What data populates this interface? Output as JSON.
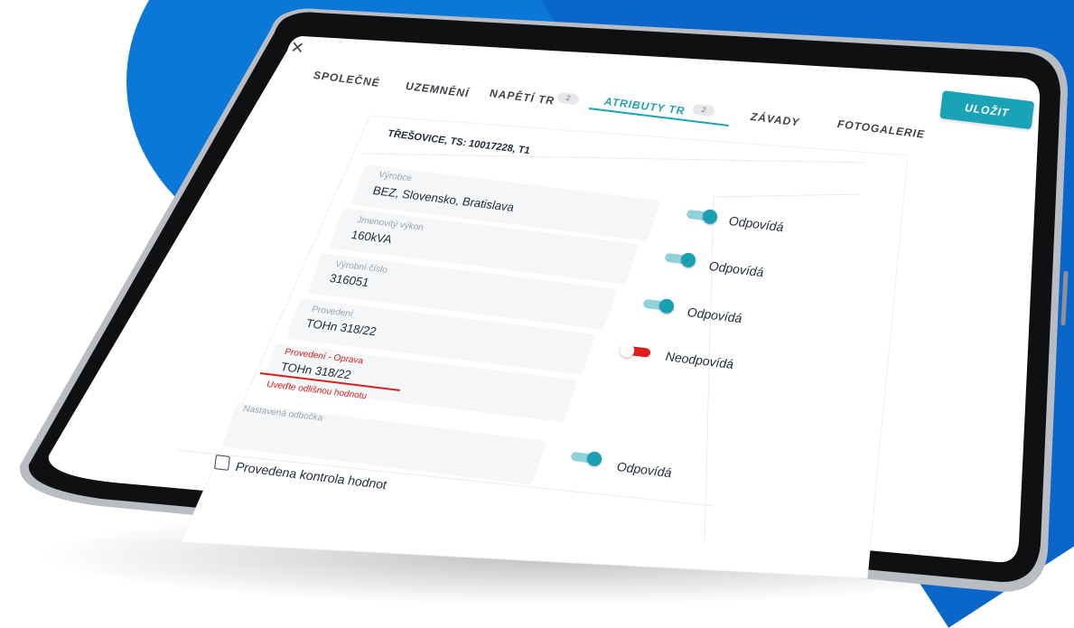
{
  "tabs": [
    {
      "label": "SPOLEČNÉ"
    },
    {
      "label": "UZEMNĚNÍ"
    },
    {
      "label": "NAPĚTÍ TR",
      "badge": "2"
    },
    {
      "label": "ATRIBUTY TR",
      "badge": "2",
      "active": true
    },
    {
      "label": "ZÁVADY"
    },
    {
      "label": "FOTOGALERIE"
    }
  ],
  "save_label": "ULOŽIT",
  "close_icon": "close-icon",
  "panel_title": "TŘEŠOVICE, TS: 10017228, T1",
  "fields": [
    {
      "label": "Výrobce",
      "value": "BEZ, Slovensko, Bratislava",
      "status": "Odpovídá",
      "toggle": "on"
    },
    {
      "label": "Jmenovitý výkon",
      "value": "160kVA",
      "status": "Odpovídá",
      "toggle": "on"
    },
    {
      "label": "Výrobní číslo",
      "value": "316051",
      "status": "Odpovídá",
      "toggle": "on"
    },
    {
      "label": "Provedení",
      "value": "TOHn 318/22",
      "status": "Neodpovídá",
      "toggle": "off"
    },
    {
      "label": "Provedení - Oprava",
      "value": "TOHn 318/22",
      "error": "Uveďte odlišnou hodnotu"
    },
    {
      "label": "Nastavená odbočka",
      "value": "",
      "status": "Odpovídá",
      "toggle": "on"
    }
  ],
  "checkbox_label": "Provedena kontrola hodnot",
  "colors": {
    "accent": "#1aa2b7",
    "error": "#d62020",
    "background_blue": "#0a6fd0"
  }
}
